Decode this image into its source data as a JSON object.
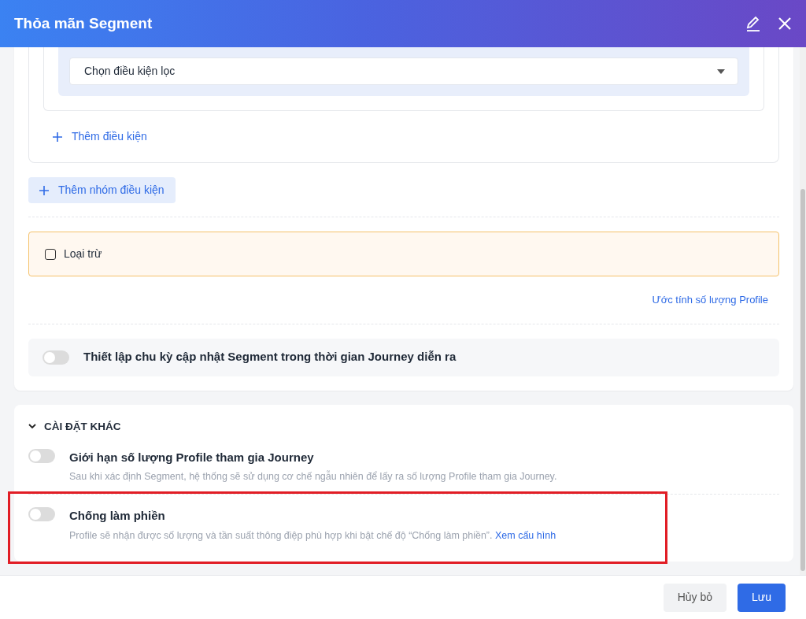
{
  "header": {
    "title": "Thỏa mãn Segment"
  },
  "filter_select": {
    "text": "Chọn điều kiện lọc"
  },
  "add_condition": "Thêm điều kiện",
  "add_group": "Thêm nhóm điều kiện",
  "exclude": {
    "label": "Loại trừ",
    "checked": false
  },
  "estimate_link": "Ước tính số lượng Profile",
  "update_cycle": {
    "label": "Thiết lập chu kỳ cập nhật Segment trong thời gian Journey diễn ra",
    "on": false
  },
  "other_settings": {
    "title": "CÀI ĐẶT KHÁC",
    "expanded": true,
    "items": [
      {
        "title": "Giới hạn số lượng Profile tham gia Journey",
        "description": "Sau khi xác định Segment, hệ thống sẽ sử dụng cơ chế ngẫu nhiên để lấy ra số lượng Profile tham gia Journey.",
        "on": false,
        "highlighted": false
      },
      {
        "title": "Chống làm phiền",
        "description": "Profile sẽ nhận được số lượng và tần suất thông điệp phù hợp khi bật chế độ “Chống làm phiền”.",
        "link": "Xem cấu hình",
        "on": false,
        "highlighted": true
      }
    ]
  },
  "footer": {
    "buttons": [
      {
        "label": "Hủy bỏ",
        "kind": "secondary"
      },
      {
        "label": "Lưu",
        "kind": "primary"
      }
    ]
  }
}
